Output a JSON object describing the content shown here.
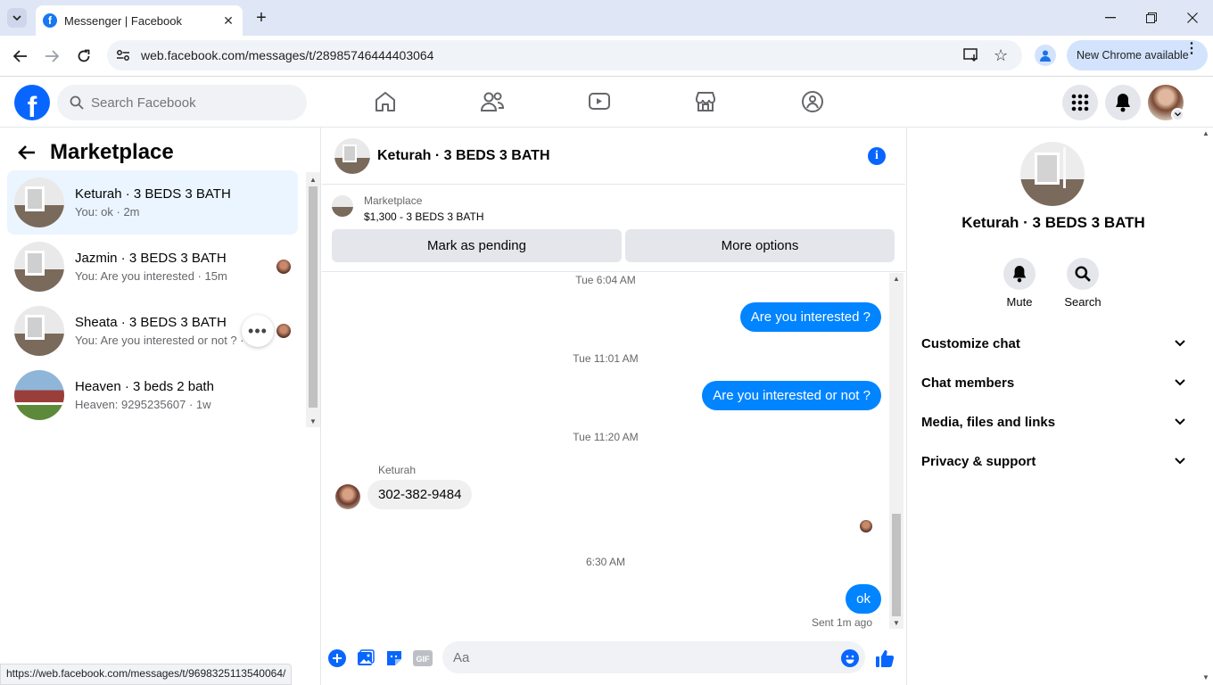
{
  "browser": {
    "tab_title": "Messenger | Facebook",
    "url": "web.facebook.com/messages/t/28985746444403064",
    "new_chrome_label": "New Chrome available",
    "status_url": "https://web.facebook.com/messages/t/9698325113540064/"
  },
  "fb_header": {
    "search_placeholder": "Search Facebook"
  },
  "left_panel": {
    "title": "Marketplace",
    "conversations": [
      {
        "name": "Keturah · 3 BEDS 3 BATH",
        "preview": "You: ok · 2m"
      },
      {
        "name": "Jazmin · 3 BEDS 3 BATH",
        "preview": "You: Are you interested · 15m"
      },
      {
        "name": "Sheata · 3 BEDS 3 BATH",
        "preview": "You: Are you interested or not ? ·"
      },
      {
        "name": "Heaven · 3 beds 2 bath",
        "preview": "Heaven: 9295235607 · 1w"
      }
    ]
  },
  "chat": {
    "header_name": "Keturah · 3 BEDS 3 BATH",
    "marketplace_label": "Marketplace",
    "listing": "$1,300 - 3 BEDS 3 BATH",
    "mark_pending": "Mark as pending",
    "more_options": "More options",
    "messages": {
      "ts1": "Tue 6:04 AM",
      "out1": "Are you interested ?",
      "ts2": "Tue 11:01 AM",
      "out2": "Are you interested or not ?",
      "ts3": "Tue 11:20 AM",
      "sender": "Keturah",
      "in1": "302-382-9484",
      "ts4": "6:30 AM",
      "out3": "ok",
      "sent_status": "Sent 1m ago"
    },
    "composer_placeholder": "Aa"
  },
  "right_panel": {
    "name": "Keturah · 3 BEDS 3 BATH",
    "mute": "Mute",
    "search": "Search",
    "sections": [
      "Customize chat",
      "Chat members",
      "Media, files and links",
      "Privacy & support"
    ]
  },
  "colors": {
    "accent": "#0084ff",
    "fb_blue": "#0866ff",
    "active_row": "#ebf5ff"
  }
}
